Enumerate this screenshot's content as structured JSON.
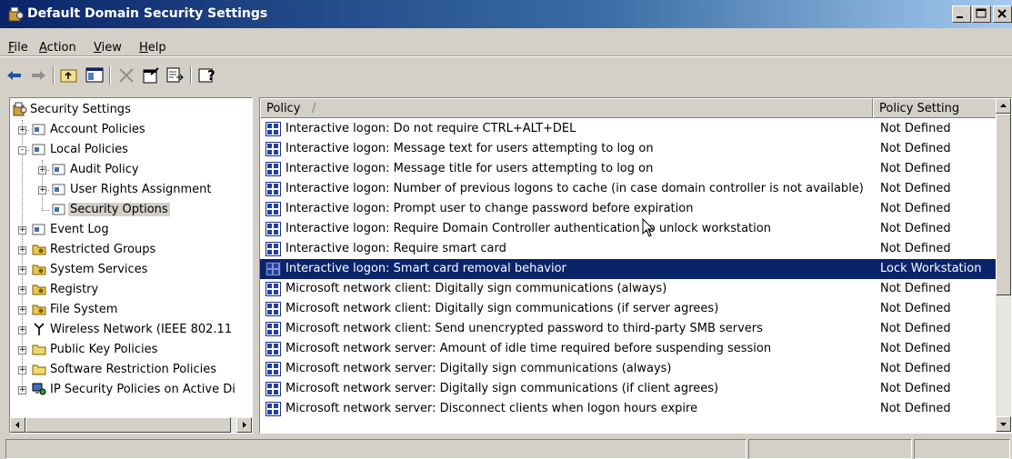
{
  "window": {
    "title": "Default Domain Security Settings",
    "controls": [
      "minimize-icon",
      "maximize-icon",
      "close-icon"
    ]
  },
  "menu": [
    {
      "label": "File",
      "accel": "F"
    },
    {
      "label": "Action",
      "accel": "A"
    },
    {
      "label": "View",
      "accel": "V"
    },
    {
      "label": "Help",
      "accel": "H"
    }
  ],
  "toolbar": {
    "icons": [
      "back-arrow-icon",
      "forward-arrow-icon",
      "up-folder-icon",
      "show-hide-tree-icon",
      "delete-icon",
      "properties-icon",
      "export-list-icon",
      "help-icon"
    ]
  },
  "tree": {
    "root": "Security Settings",
    "items": [
      {
        "label": "Account Policies",
        "expander": "+"
      },
      {
        "label": "Local Policies",
        "expander": "-"
      },
      {
        "label": "Audit Policy",
        "expander": "+"
      },
      {
        "label": "User Rights Assignment",
        "expander": "+"
      },
      {
        "label": "Security Options",
        "expander": ""
      },
      {
        "label": "Event Log",
        "expander": "+"
      },
      {
        "label": "Restricted Groups",
        "expander": "+"
      },
      {
        "label": "System Services",
        "expander": "+"
      },
      {
        "label": "Registry",
        "expander": "+"
      },
      {
        "label": "File System",
        "expander": "+"
      },
      {
        "label": "Wireless Network (IEEE 802.11",
        "expander": "+"
      },
      {
        "label": "Public Key Policies",
        "expander": "+"
      },
      {
        "label": "Software Restriction Policies",
        "expander": "+"
      },
      {
        "label": "IP Security Policies on Active Di",
        "expander": "+"
      }
    ],
    "selected": "Security Options"
  },
  "list": {
    "columns": {
      "policy": "Policy",
      "setting": "Policy Setting"
    },
    "sort_indicator": "/",
    "rows": [
      {
        "policy": "Interactive logon: Do not require CTRL+ALT+DEL",
        "setting": "Not Defined"
      },
      {
        "policy": "Interactive logon: Message text for users attempting to log on",
        "setting": "Not Defined"
      },
      {
        "policy": "Interactive logon: Message title for users attempting to log on",
        "setting": "Not Defined"
      },
      {
        "policy": "Interactive logon: Number of previous logons to cache (in case domain controller is not available)",
        "setting": "Not Defined"
      },
      {
        "policy": "Interactive logon: Prompt user to change password before expiration",
        "setting": "Not Defined"
      },
      {
        "policy": "Interactive logon: Require Domain Controller authentication to unlock workstation",
        "setting": "Not Defined"
      },
      {
        "policy": "Interactive logon: Require smart card",
        "setting": "Not Defined"
      },
      {
        "policy": "Interactive logon: Smart card removal behavior",
        "setting": "Lock Workstation"
      },
      {
        "policy": "Microsoft network client: Digitally sign communications (always)",
        "setting": "Not Defined"
      },
      {
        "policy": "Microsoft network client: Digitally sign communications (if server agrees)",
        "setting": "Not Defined"
      },
      {
        "policy": "Microsoft network client: Send unencrypted password to third-party SMB servers",
        "setting": "Not Defined"
      },
      {
        "policy": "Microsoft network server: Amount of idle time required before suspending session",
        "setting": "Not Defined"
      },
      {
        "policy": "Microsoft network server: Digitally sign communications (always)",
        "setting": "Not Defined"
      },
      {
        "policy": "Microsoft network server: Digitally sign communications (if client agrees)",
        "setting": "Not Defined"
      },
      {
        "policy": "Microsoft network server: Disconnect clients when logon hours expire",
        "setting": "Not Defined"
      }
    ],
    "selected_index": 7
  },
  "colors": {
    "title_start": "#0a246a",
    "title_end": "#a6caf0",
    "selection": "#0a246a",
    "chrome": "#d4d0c8"
  }
}
